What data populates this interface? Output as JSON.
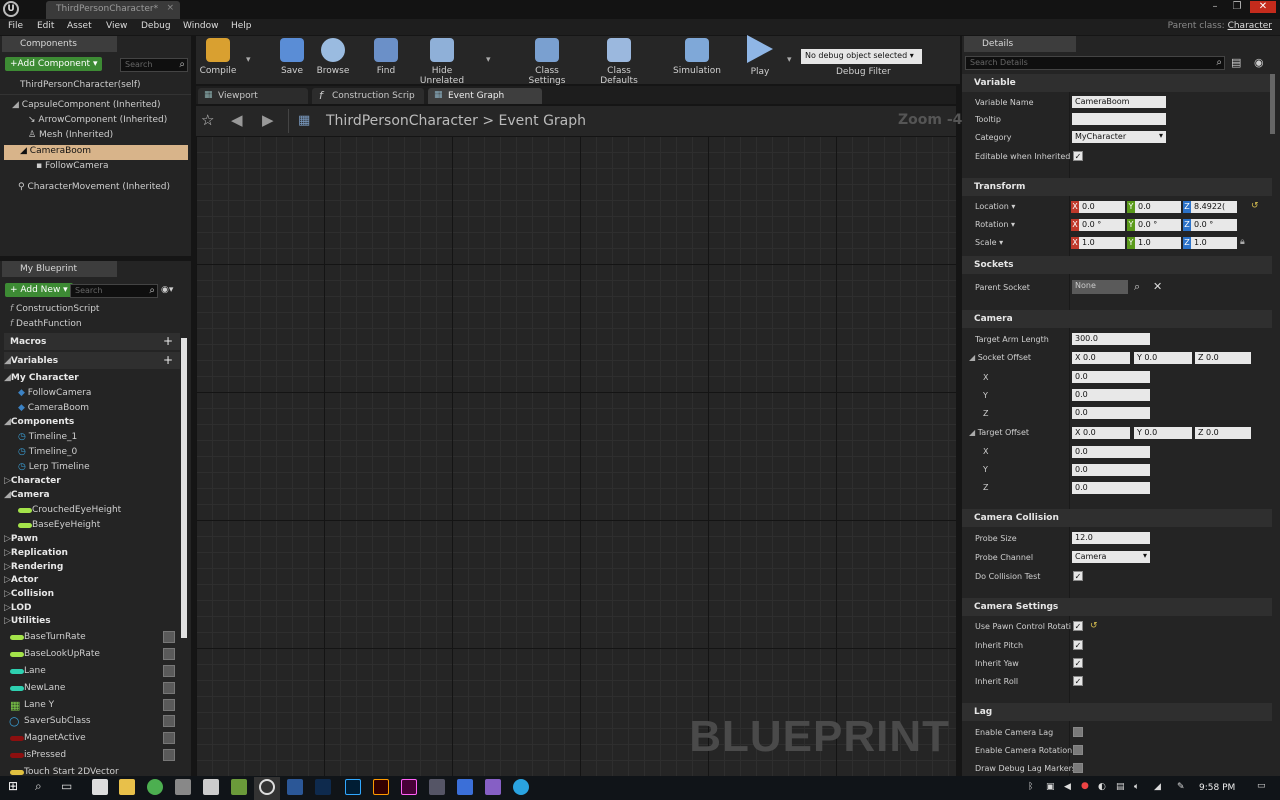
{
  "window": {
    "tab_title": "ThirdPersonCharacter*",
    "parent_class_label": "Parent class:",
    "parent_class": "Character"
  },
  "menu": [
    "File",
    "Edit",
    "Asset",
    "View",
    "Debug",
    "Window",
    "Help"
  ],
  "components": {
    "tab": "Components",
    "add_button": "+Add Component ▾",
    "search_placeholder": "Search",
    "self": "ThirdPersonCharacter(self)",
    "items": [
      "CapsuleComponent (Inherited)",
      "ArrowComponent (Inherited)",
      "Mesh (Inherited)",
      "CameraBoom",
      "FollowCamera",
      "CharacterMovement (Inherited)"
    ]
  },
  "my_blueprint": {
    "tab": "My Blueprint",
    "add_button": "+ Add New ▾",
    "search_placeholder": "Search",
    "functions": [
      "ConstructionScript",
      "DeathFunction"
    ],
    "macros": "Macros",
    "variables": "Variables",
    "categories": {
      "my_character": "My Character",
      "my_character_vars": [
        "FollowCamera",
        "CameraBoom"
      ],
      "components": "Components",
      "components_vars": [
        "Timeline_1",
        "Timeline_0",
        "Lerp Timeline"
      ],
      "character": "Character",
      "camera": "Camera",
      "camera_vars": [
        "CrouchedEyeHeight",
        "BaseEyeHeight"
      ],
      "collapsed": [
        "Pawn",
        "Replication",
        "Rendering",
        "Actor",
        "Collision",
        "LOD",
        "Utilities"
      ]
    },
    "loose_vars": [
      "BaseTurnRate",
      "BaseLookUpRate",
      "Lane",
      "NewLane",
      "Lane Y",
      "SaverSubClass",
      "MagnetActive",
      "isPressed",
      "Touch Start 2DVector"
    ]
  },
  "toolbar": {
    "compile": "Compile",
    "save": "Save",
    "browse": "Browse",
    "find": "Find",
    "hide_unrelated": "Hide Unrelated",
    "class_settings": "Class Settings",
    "class_defaults": "Class Defaults",
    "simulation": "Simulation",
    "play": "Play",
    "debug_object": "No debug object selected ▾",
    "debug_filter": "Debug Filter"
  },
  "graph": {
    "tabs": [
      "Viewport",
      "Construction Scrip",
      "Event Graph"
    ],
    "breadcrumb_class": "ThirdPersonCharacter",
    "breadcrumb_sep": ">",
    "breadcrumb_graph": "Event Graph",
    "zoom": "Zoom -4",
    "watermark": "BLUEPRINT"
  },
  "details": {
    "tab": "Details",
    "search_placeholder": "Search Details",
    "variable": {
      "header": "Variable",
      "name_label": "Variable Name",
      "name_value": "CameraBoom",
      "tooltip_label": "Tooltip",
      "tooltip_value": "",
      "category_label": "Category",
      "category_value": "MyCharacter",
      "editable_label": "Editable when Inherited"
    },
    "transform": {
      "header": "Transform",
      "location_label": "Location ▾",
      "location": [
        "0.0",
        "0.0",
        "8.4922("
      ],
      "rotation_label": "Rotation ▾",
      "rotation": [
        "0.0 °",
        "0.0 °",
        "0.0 °"
      ],
      "scale_label": "Scale ▾",
      "scale": [
        "1.0",
        "1.0",
        "1.0"
      ]
    },
    "sockets": {
      "header": "Sockets",
      "parent_label": "Parent Socket",
      "parent_value": "None"
    },
    "camera": {
      "header": "Camera",
      "arm_label": "Target Arm Length",
      "arm_value": "300.0",
      "socket_label": "Socket Offset",
      "socket_row": [
        "X  0.0",
        "Y  0.0",
        "Z  0.0"
      ],
      "socket": [
        "0.0",
        "0.0",
        "0.0"
      ],
      "target_label": "Target Offset",
      "target_row": [
        "X  0.0",
        "Y  0.0",
        "Z  0.0"
      ],
      "target": [
        "0.0",
        "0.0",
        "0.0"
      ],
      "axis": [
        "X",
        "Y",
        "Z"
      ]
    },
    "collision": {
      "header": "Camera Collision",
      "probe_size_label": "Probe Size",
      "probe_size": "12.0",
      "probe_channel_label": "Probe Channel",
      "probe_channel": "Camera",
      "test_label": "Do Collision Test"
    },
    "settings": {
      "header": "Camera Settings",
      "items": [
        "Use Pawn Control Rotati",
        "Inherit Pitch",
        "Inherit Yaw",
        "Inherit Roll"
      ]
    },
    "lag": {
      "header": "Lag",
      "items": [
        "Enable Camera Lag",
        "Enable Camera Rotation",
        "Draw Debug Lag Markers"
      ]
    }
  },
  "taskbar": {
    "time": "9:58 PM"
  },
  "colors": {
    "accent_green": "#3d8b34",
    "selected_row": "#d8b48a",
    "panel": "#242424"
  }
}
